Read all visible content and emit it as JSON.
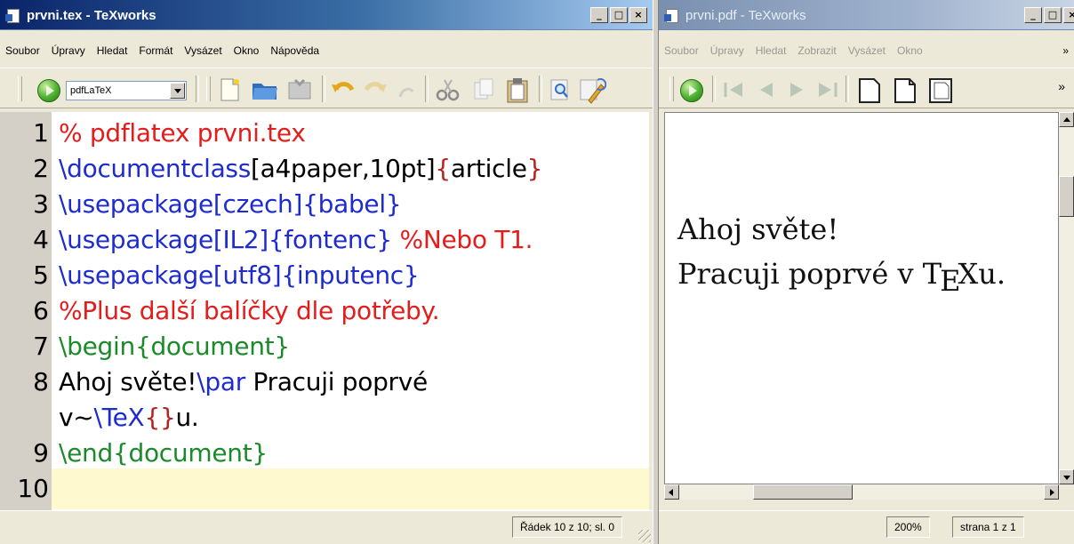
{
  "editor": {
    "title": "prvni.tex - TeXworks",
    "window_buttons": [
      "_",
      "□",
      "×"
    ],
    "menu": [
      "Soubor",
      "Úpravy",
      "Hledat",
      "Formát",
      "Vysázet",
      "Okno",
      "Nápověda"
    ],
    "engine": "pdfLaTeX",
    "line_numbers": [
      "1",
      "2",
      "3",
      "4",
      "5",
      "6",
      "7",
      "8",
      "9",
      "10"
    ],
    "code": {
      "l1": {
        "comment": "% pdflatex prvni.tex"
      },
      "l2": {
        "cmd": "\\documentclass",
        "opt": "[a4paper,10pt]",
        "ob": "{",
        "arg": "article",
        "cb": "}"
      },
      "l3": {
        "cmd": "\\usepackage",
        "rest": "[czech]{babel}"
      },
      "l4": {
        "cmd": "\\usepackage",
        "rest": "[IL2]{fontenc}",
        "comment": " %Nebo T1."
      },
      "l5": {
        "cmd": "\\usepackage",
        "rest": "[utf8]{inputenc}"
      },
      "l6": {
        "comment": "%Plus další balíčky dle potřeby."
      },
      "l7": {
        "cmd": "\\begin",
        "arg": "{document}"
      },
      "l8": {
        "text1": "Ahoj světe!",
        "cmd": "\\par",
        "text2": " Pracuji poprvé"
      },
      "l8b": {
        "text1": "v~",
        "cmd": "\\TeX",
        "brk": "{}",
        "text2": "u."
      },
      "l9": {
        "cmd": "\\end",
        "arg": "{document}"
      }
    },
    "status": "Řádek 10 z 10; sl. 0"
  },
  "pdf": {
    "title": "prvni.pdf - TeXworks",
    "window_buttons": [
      "_",
      "□",
      "×"
    ],
    "menu": [
      "Soubor",
      "Úpravy",
      "Hledat",
      "Zobrazit",
      "Vysázet",
      "Okno"
    ],
    "menu_more": "»",
    "toolbar_more": "»",
    "line1": "Ahoj světe!",
    "line2_pre": "Pracuji poprvé v T",
    "line2_e": "E",
    "line2_post": "Xu.",
    "zoom": "200%",
    "page": "strana 1 z 1"
  }
}
